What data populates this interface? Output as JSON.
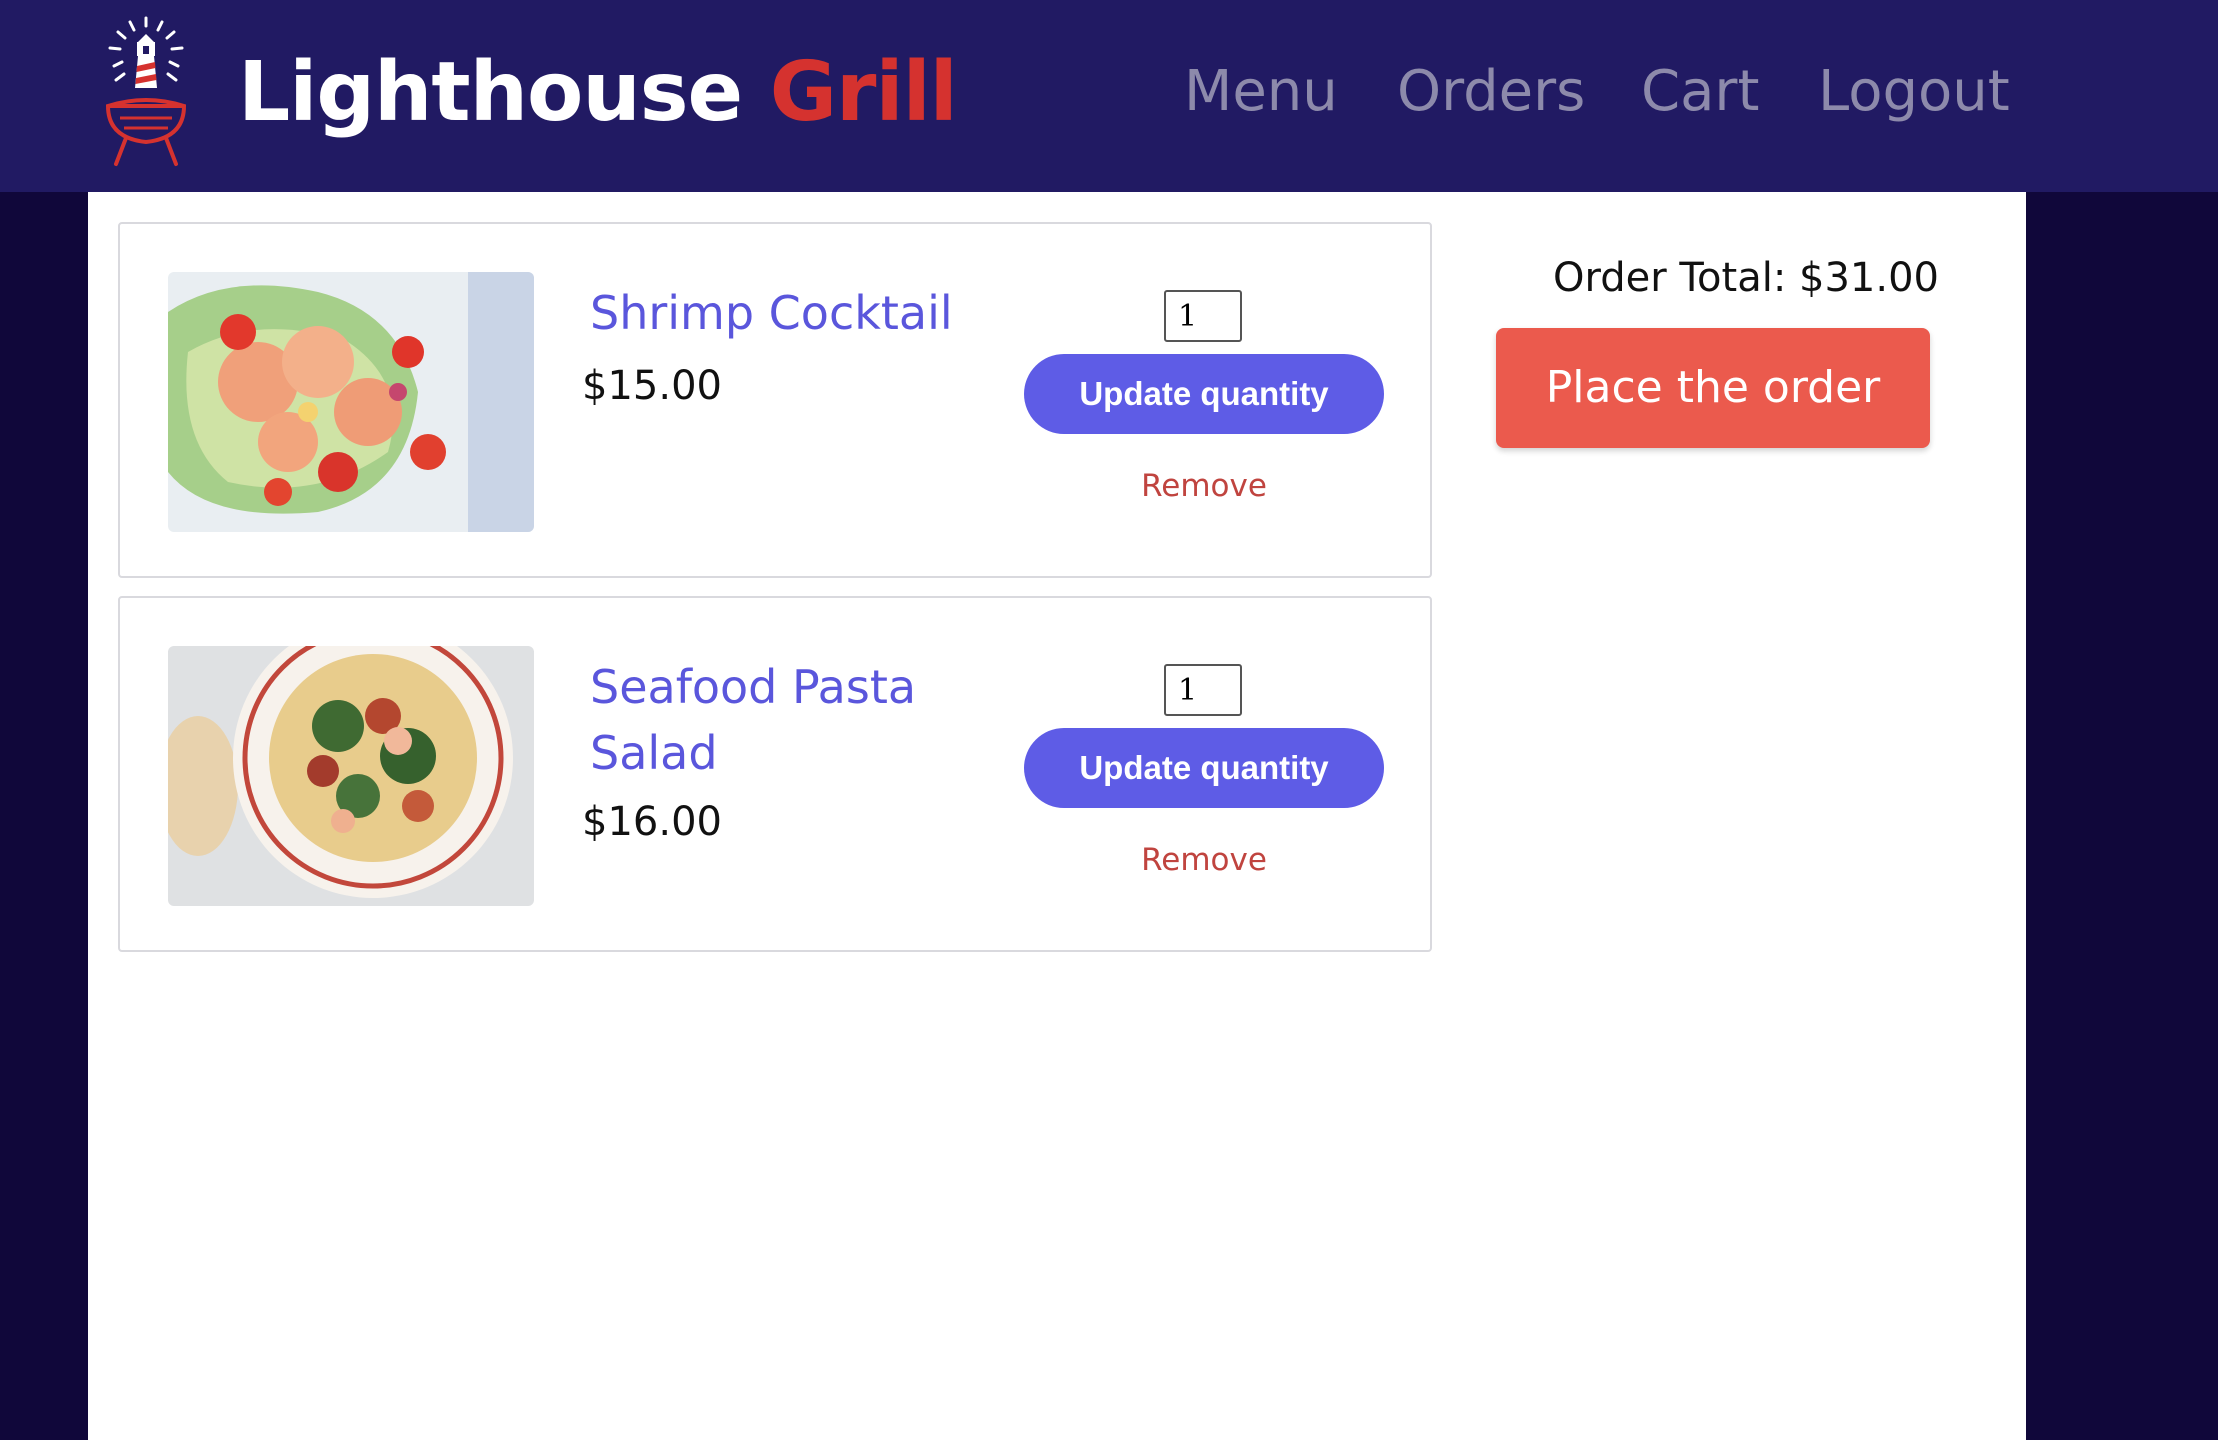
{
  "brand": {
    "name_part1": "Lighthouse",
    "name_part2": "Grill",
    "logo_icon": "lighthouse-grill-logo"
  },
  "nav": {
    "items": [
      {
        "label": "Menu"
      },
      {
        "label": "Orders"
      },
      {
        "label": "Cart"
      },
      {
        "label": "Logout"
      }
    ]
  },
  "cart": {
    "items": [
      {
        "name": "Shrimp Cocktail",
        "price": "$15.00",
        "quantity": "1",
        "update_label": "Update quantity",
        "remove_label": "Remove",
        "image": "shrimp-cocktail-photo"
      },
      {
        "name": "Seafood Pasta Salad",
        "price": "$16.00",
        "quantity": "1",
        "update_label": "Update quantity",
        "remove_label": "Remove",
        "image": "seafood-pasta-salad-photo"
      }
    ]
  },
  "summary": {
    "order_total": "Order Total: $31.00",
    "place_order_label": "Place the order"
  },
  "colors": {
    "header_bg": "#211a63",
    "page_bg": "#10073a",
    "accent_purple": "#5e5ce6",
    "accent_red": "#eb5a4d",
    "brand_red": "#d5322f"
  }
}
